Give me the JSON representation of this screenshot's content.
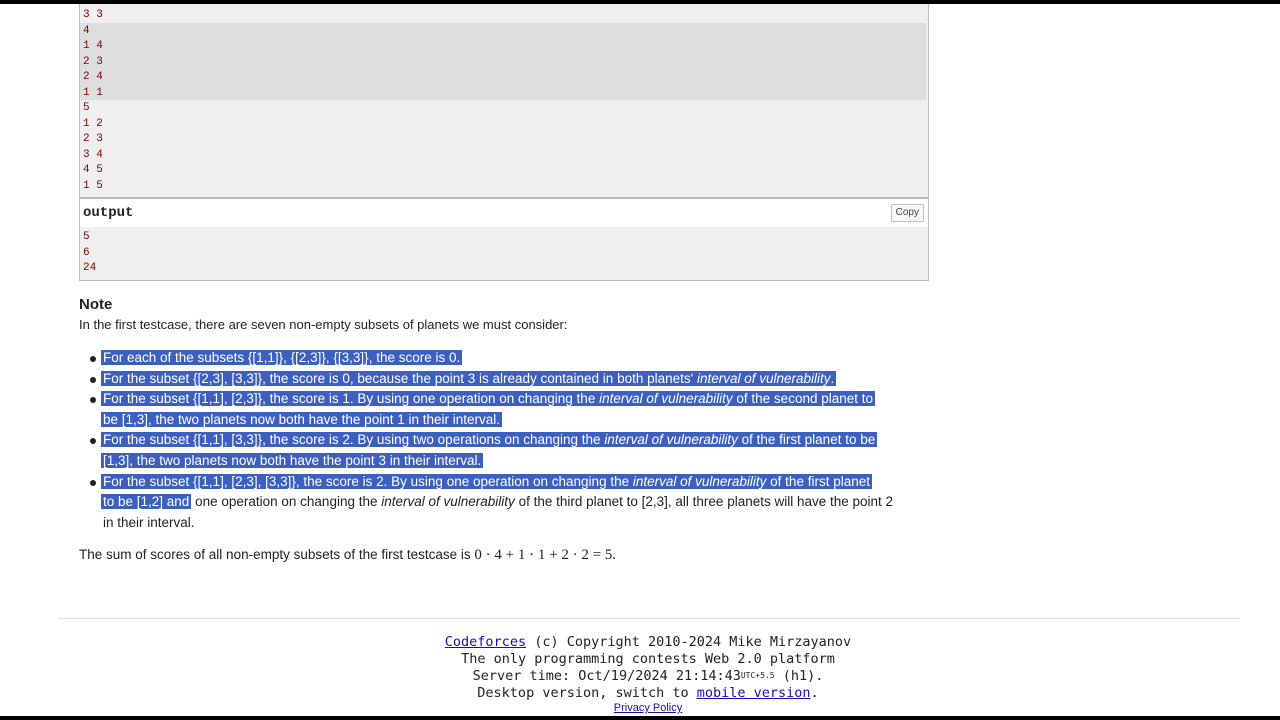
{
  "input_lines": [
    "3 3",
    "4",
    "1 4",
    "2 3",
    "2 4",
    "1 1",
    "5",
    "1 2",
    "2 3",
    "3 4",
    "4 5",
    "1 5"
  ],
  "output": {
    "title": "output",
    "copy_label": "Copy",
    "lines": [
      "5",
      "6",
      "24"
    ]
  },
  "note": {
    "title": "Note",
    "intro": "In the first testcase, there are seven non-empty subsets of planets we must consider:",
    "bullet1": {
      "text": "For each of the subsets {[1,1]}, {[2,3]}, {[3,3]}, the score is 0."
    },
    "bullet2": {
      "a": "For the subset {[2,3], [3,3]}, the score is 0, because the point 3 is already contained in both planets' ",
      "em": "interval of vulnerability",
      "b": "."
    },
    "bullet3": {
      "a": "For the subset {[1,1], [2,3]}, the score is 1. By using one operation on changing the ",
      "em": "interval of vulnerability",
      "b": " of the second planet to",
      "line2": "be [1,3], the two planets now both have the point 1 in their interval."
    },
    "bullet4": {
      "a": "For the subset {[1,1], [3,3]}, the score is 2. By using two operations on changing the ",
      "em": "interval of vulnerability",
      "b": " of the first planet to be",
      "line2": "[1,3], the two planets now both have the point 3 in their interval."
    },
    "bullet5": {
      "a": "For the subset {[1,1], [2,3], [3,3]}, the score is 2. By using one operation on changing the ",
      "em": "interval of vulnerability",
      "b": " of the first planet",
      "line2_sel": "to be [1,2] and",
      "line2_a": " one operation on changing the ",
      "line2_em": "interval of vulnerability",
      "line2_b": " of the third planet to [2,3], all three planets will have the point 2",
      "line3": "in their interval."
    },
    "summary_text": "The sum of scores of all non-empty subsets of the first testcase is ",
    "summary_math": "0 · 4 + 1 · 1 + 2 · 2 = 5."
  },
  "footer": {
    "codeforces_link": "Codeforces",
    "copyright": " (c) Copyright 2010-2024 Mike Mirzayanov",
    "tagline": "The only programming contests Web 2.0 platform",
    "server_prefix": "Server time: Oct/19/2024 21:14:43",
    "utc": "UTC+5.5",
    "server_suffix": " (h1).",
    "desktop_prefix": "Desktop version, switch to ",
    "mobile_link": "mobile version",
    "desktop_suffix": ".",
    "privacy": "Privacy Policy"
  }
}
